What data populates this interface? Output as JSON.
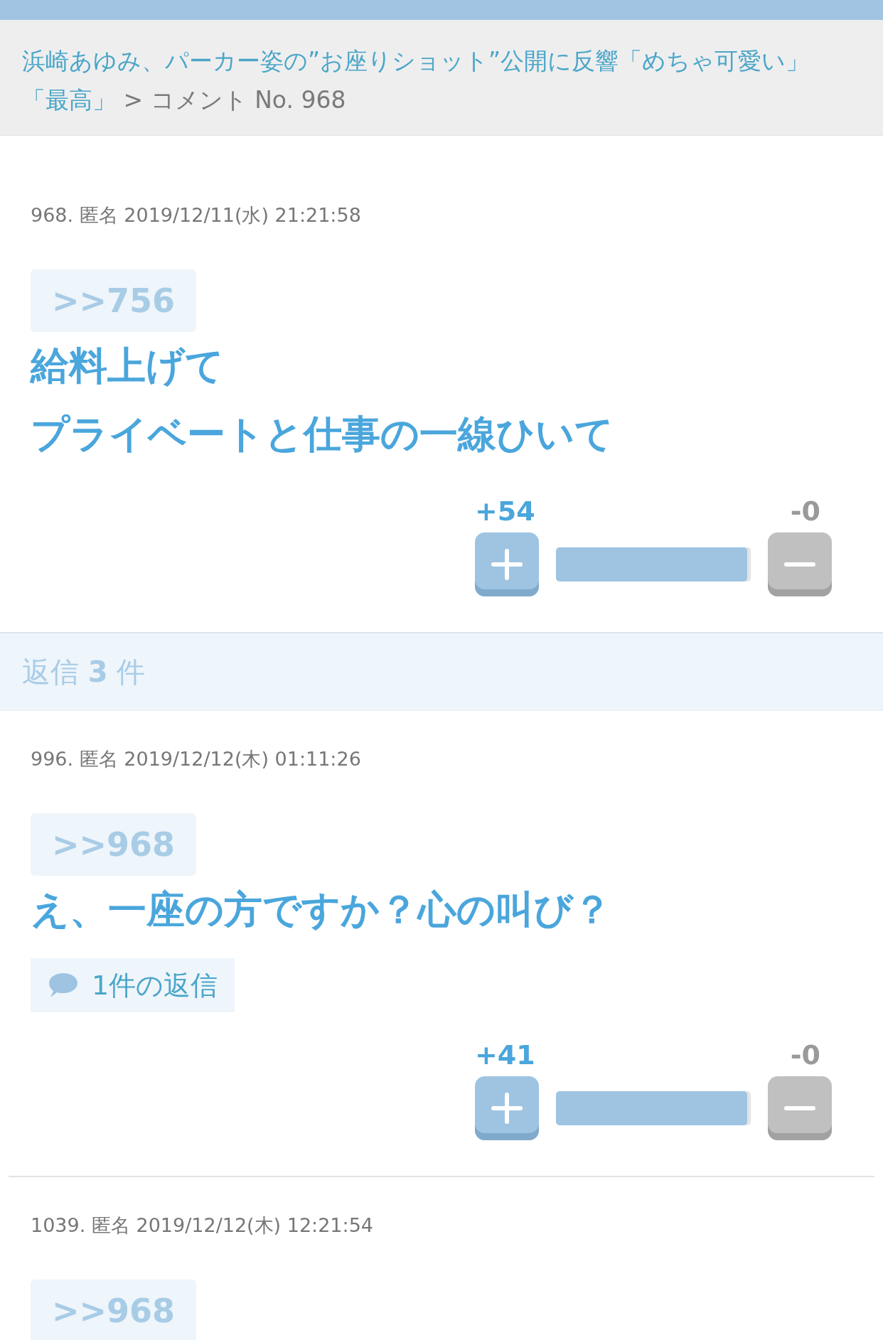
{
  "breadcrumb": {
    "article_link": "浜崎あゆみ、パーカー姿の”お座りショット”公開に反響「めちゃ可愛い」「最高」",
    "separator": ">",
    "current": "コメント No. 968"
  },
  "comment": {
    "meta": "968. 匿名 2019/12/11(水) 21:21:58",
    "anchor": ">>756",
    "body_lines": [
      "給料上げて",
      "プライベートと仕事の一線ひいて"
    ],
    "plus": "+54",
    "minus": "-0",
    "level": 0.98
  },
  "replies_header": "返信 **3** 件",
  "replies": [
    {
      "meta": "996. 匿名 2019/12/12(木) 01:11:26",
      "anchor": ">>968",
      "body_lines": [
        "え、一座の方ですか？心の叫び？"
      ],
      "reply_link": "1件の返信",
      "plus": "+41",
      "minus": "-0",
      "level": 0.98
    },
    {
      "meta": "1039. 匿名 2019/12/12(木) 12:21:54",
      "anchor": ">>968"
    }
  ]
}
